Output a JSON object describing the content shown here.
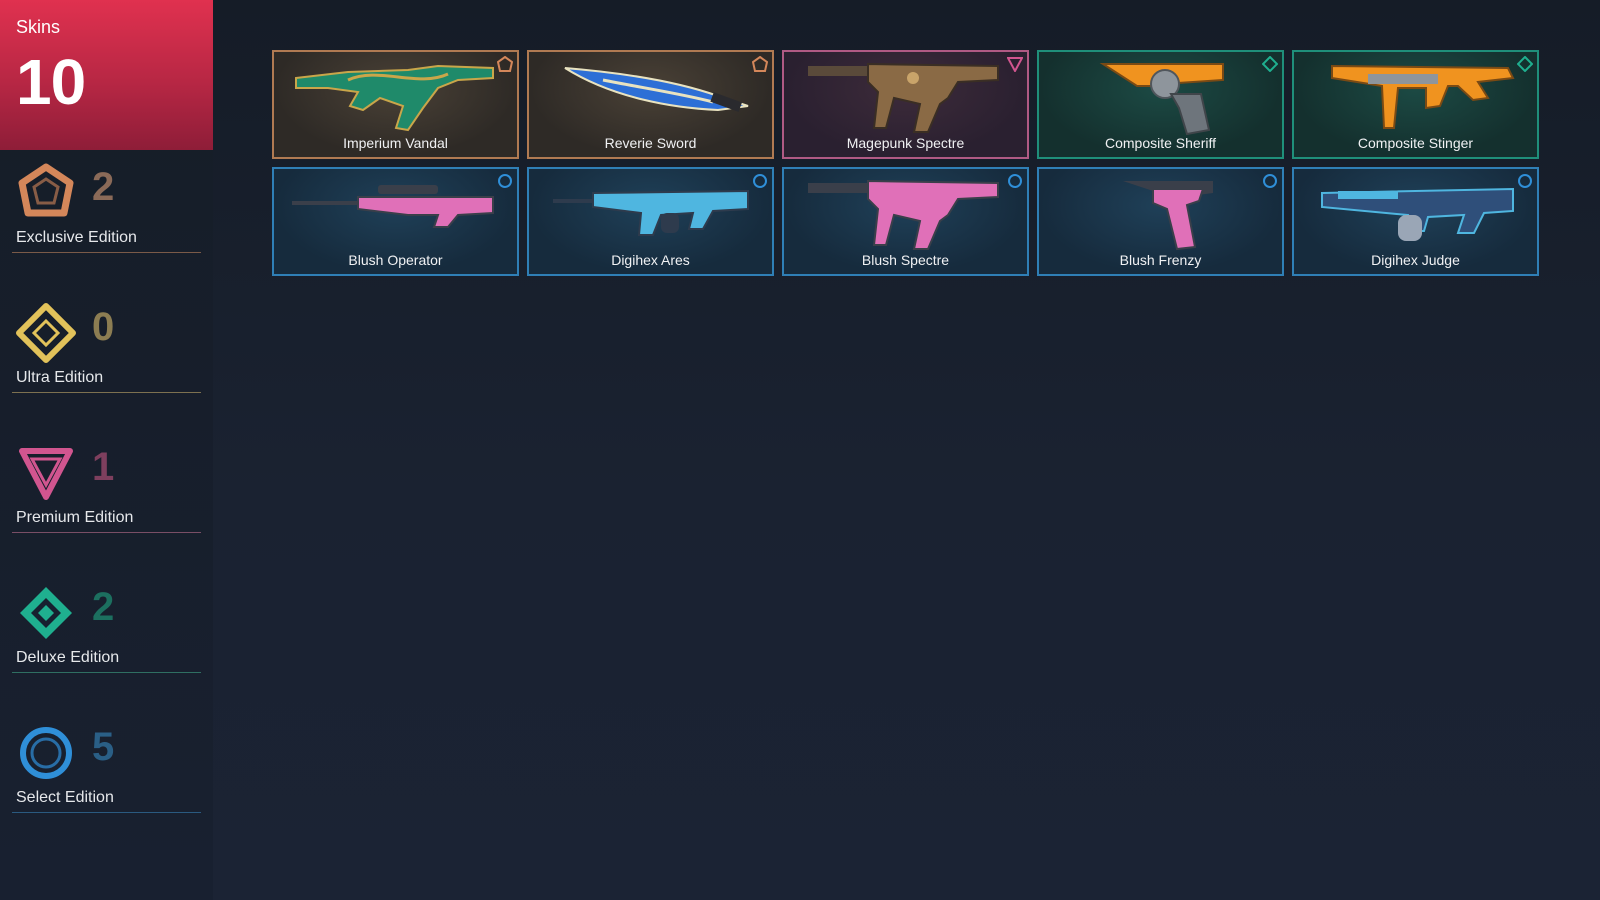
{
  "summary": {
    "label": "Skins",
    "count": "10"
  },
  "tiers": [
    {
      "key": "exclusive",
      "count": "2",
      "label": "Exclusive Edition",
      "color": "#d4875a",
      "count_color": "#8a6a58"
    },
    {
      "key": "ultra",
      "count": "0",
      "label": "Ultra Edition",
      "color": "#e2c25a",
      "count_color": "#8c7d52"
    },
    {
      "key": "premium",
      "count": "1",
      "label": "Premium Edition",
      "color": "#d1558f",
      "count_color": "#7e3f5e"
    },
    {
      "key": "deluxe",
      "count": "2",
      "label": "Deluxe Edition",
      "color": "#1faf8f",
      "count_color": "#1c6f5f"
    },
    {
      "key": "select",
      "count": "5",
      "label": "Select Edition",
      "color": "#2f8fd8",
      "count_color": "#2a5f86"
    }
  ],
  "skins": [
    {
      "name": "Imperium Vandal",
      "tier": "exclusive",
      "kind": "rifle",
      "palette": [
        "#1f8a6a",
        "#c9a64a"
      ]
    },
    {
      "name": "Reverie Sword",
      "tier": "exclusive",
      "kind": "sword",
      "palette": [
        "#2d6fd6",
        "#e9e3c0"
      ]
    },
    {
      "name": "Magepunk Spectre",
      "tier": "premium",
      "kind": "smg",
      "palette": [
        "#8a6a45",
        "#5a4a3a"
      ]
    },
    {
      "name": "Composite Sheriff",
      "tier": "deluxe",
      "kind": "pistol",
      "palette": [
        "#f0931f",
        "#8e959c"
      ]
    },
    {
      "name": "Composite Stinger",
      "tier": "deluxe",
      "kind": "smg",
      "palette": [
        "#f0931f",
        "#8e959c"
      ]
    },
    {
      "name": "Blush Operator",
      "tier": "select",
      "kind": "sniper",
      "palette": [
        "#e070b8",
        "#3a3f4a"
      ]
    },
    {
      "name": "Digihex Ares",
      "tier": "select",
      "kind": "lmg",
      "palette": [
        "#4fb6e0",
        "#2e3b4d"
      ]
    },
    {
      "name": "Blush Spectre",
      "tier": "select",
      "kind": "smg",
      "palette": [
        "#e070b8",
        "#3a3f4a"
      ]
    },
    {
      "name": "Blush Frenzy",
      "tier": "select",
      "kind": "pistol",
      "palette": [
        "#e070b8",
        "#3a3f4a"
      ]
    },
    {
      "name": "Digihex Judge",
      "tier": "select",
      "kind": "shotgun",
      "palette": [
        "#4fb6e0",
        "#2e3b4d"
      ]
    }
  ]
}
